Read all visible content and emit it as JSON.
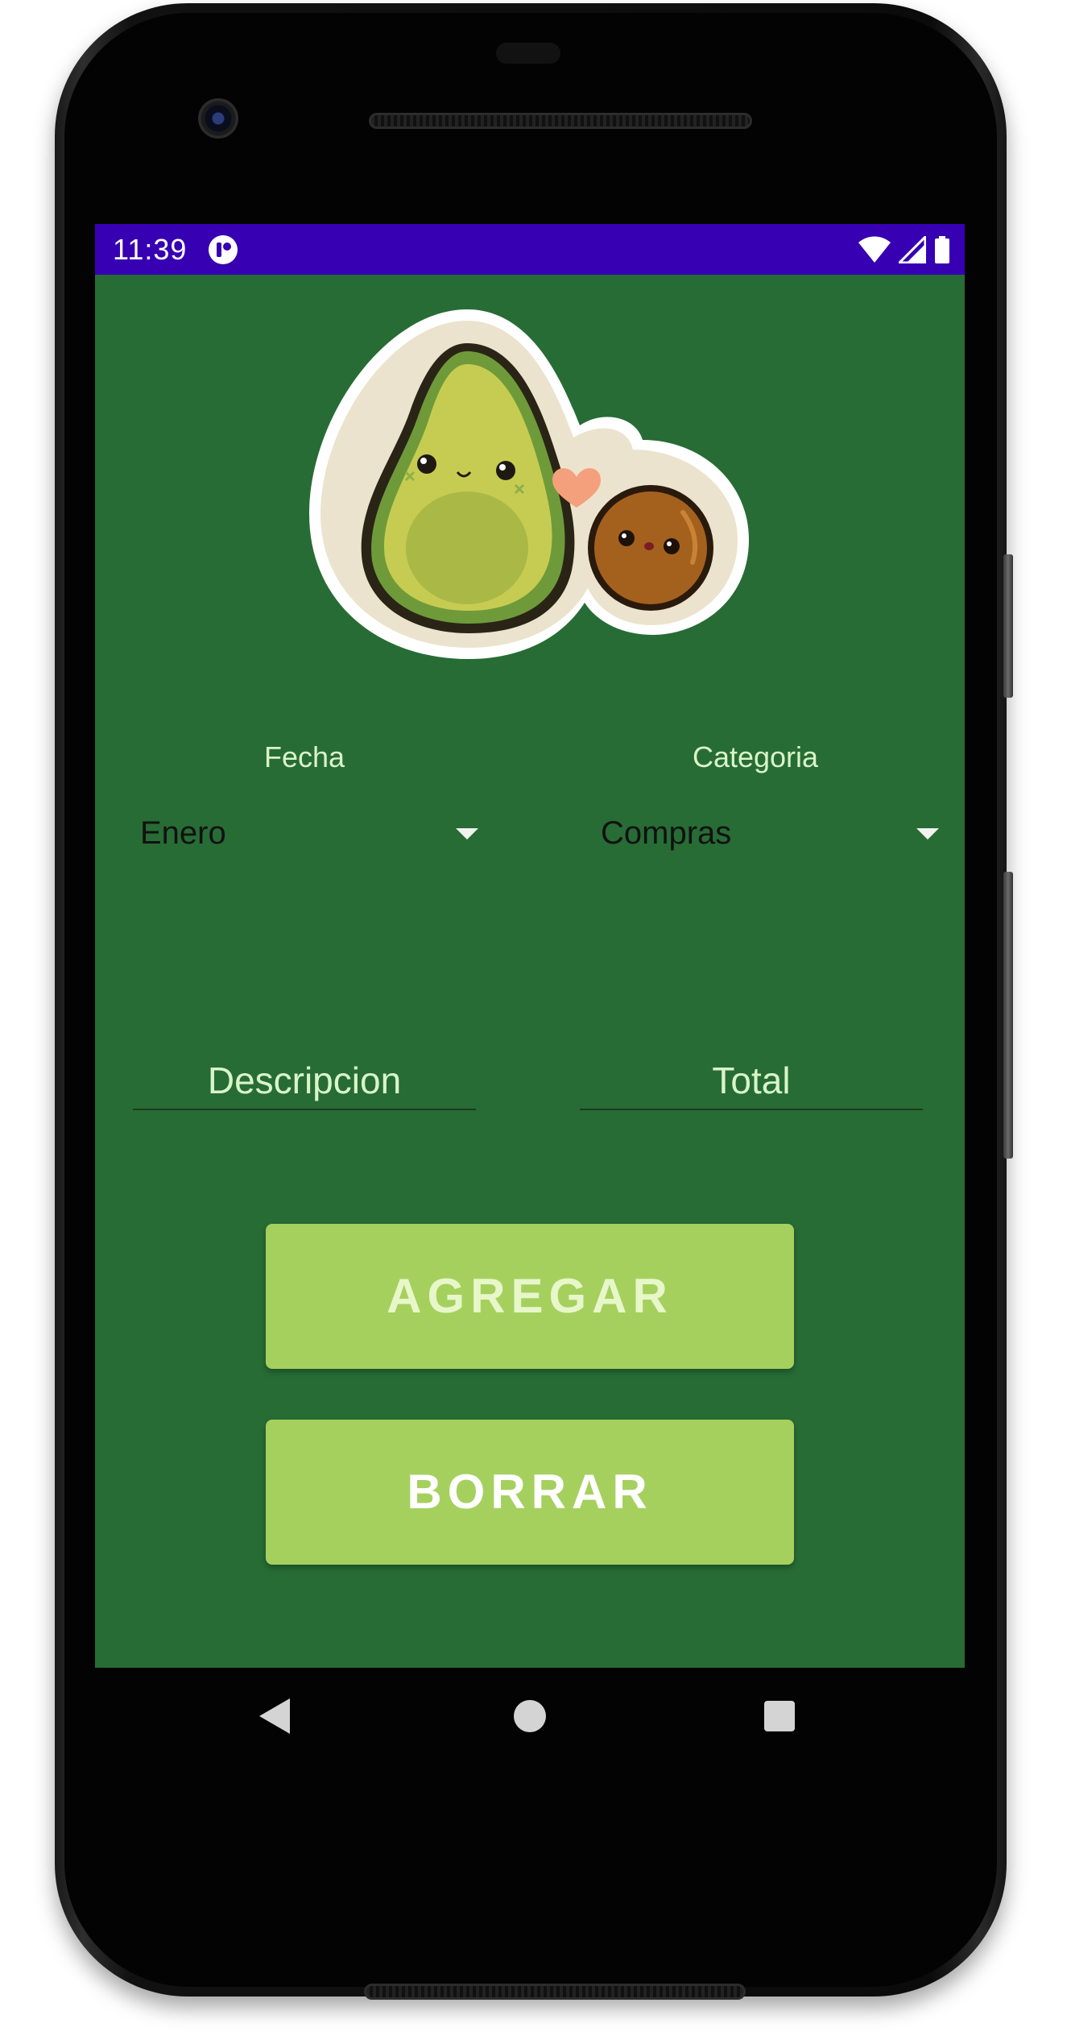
{
  "status_bar": {
    "time": "11:39",
    "background_color": "#3700b3",
    "icons": [
      "app-notification-icon",
      "wifi-icon",
      "cell-signal-icon",
      "battery-icon"
    ]
  },
  "theme": {
    "screen_background": "#276c35",
    "button_color": "#a5d05e",
    "label_color": "#d9f5c7"
  },
  "header_image": {
    "icon": "avocado-couple-illustration"
  },
  "form": {
    "fecha": {
      "label": "Fecha",
      "selected": "Enero"
    },
    "categoria": {
      "label": "Categoria",
      "selected": "Compras"
    },
    "descripcion": {
      "placeholder": "Descripcion"
    },
    "total": {
      "placeholder": "Total"
    }
  },
  "actions": {
    "add_label": "AGREGAR",
    "delete_label": "BORRAR"
  },
  "navigation": {
    "icons": [
      "back-icon",
      "home-icon",
      "recents-icon"
    ]
  }
}
